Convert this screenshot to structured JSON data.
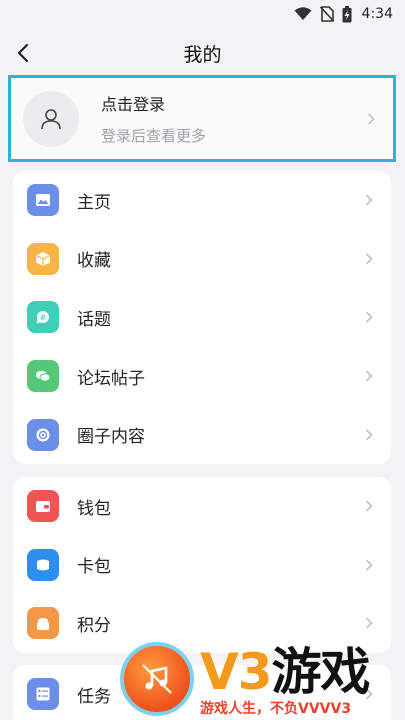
{
  "status": {
    "time": "4:34"
  },
  "nav": {
    "title": "我的"
  },
  "login": {
    "title": "点击登录",
    "subtitle": "登录后查看更多"
  },
  "group1": [
    {
      "label": "主页",
      "icon": "image-icon",
      "color": "#6b8fe8"
    },
    {
      "label": "收藏",
      "icon": "box-icon",
      "color": "#f7b547"
    },
    {
      "label": "话题",
      "icon": "hashtag-icon",
      "color": "#3fcfb8"
    },
    {
      "label": "论坛帖子",
      "icon": "chat-bubbles-icon",
      "color": "#54c879"
    },
    {
      "label": "圈子内容",
      "icon": "circle-swirl-icon",
      "color": "#6b8fe8"
    }
  ],
  "group2": [
    {
      "label": "钱包",
      "icon": "wallet-icon",
      "color": "#ef5555"
    },
    {
      "label": "卡包",
      "icon": "card-icon",
      "color": "#2c8ff0"
    },
    {
      "label": "积分",
      "icon": "coins-icon",
      "color": "#f39846"
    }
  ],
  "group3": [
    {
      "label": "任务",
      "icon": "tasklist-icon",
      "color": "#6b8fe8"
    }
  ],
  "watermark": {
    "brand_latin": "V3",
    "brand_cn": "游戏",
    "tagline": "游戏人生，不负VVVV3"
  }
}
